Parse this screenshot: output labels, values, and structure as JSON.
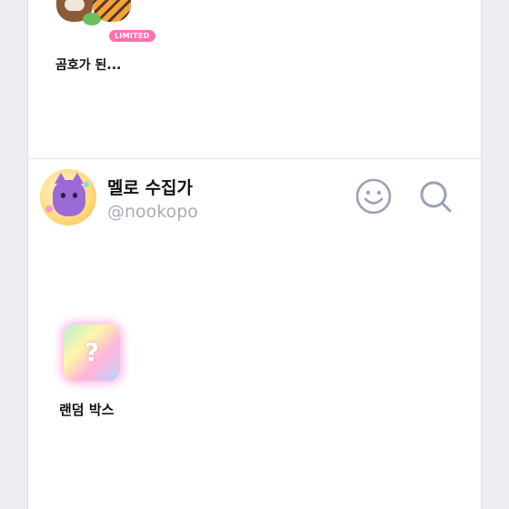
{
  "items_top": {
    "badge": "LIMITED",
    "label": "곰호가 된..."
  },
  "profile": {
    "name": "멜로 수집가",
    "handle": "@nookopo",
    "icons": [
      "emoji-icon",
      "search-icon"
    ]
  },
  "items": [
    {
      "label": "랜덤 박스",
      "glyph": "?"
    }
  ],
  "colors": {
    "background": "#eceef2",
    "panel": "#ffffff",
    "badge": "#ff6fb1",
    "handle": "#a9acb5",
    "icon": "#9ba1b3"
  }
}
